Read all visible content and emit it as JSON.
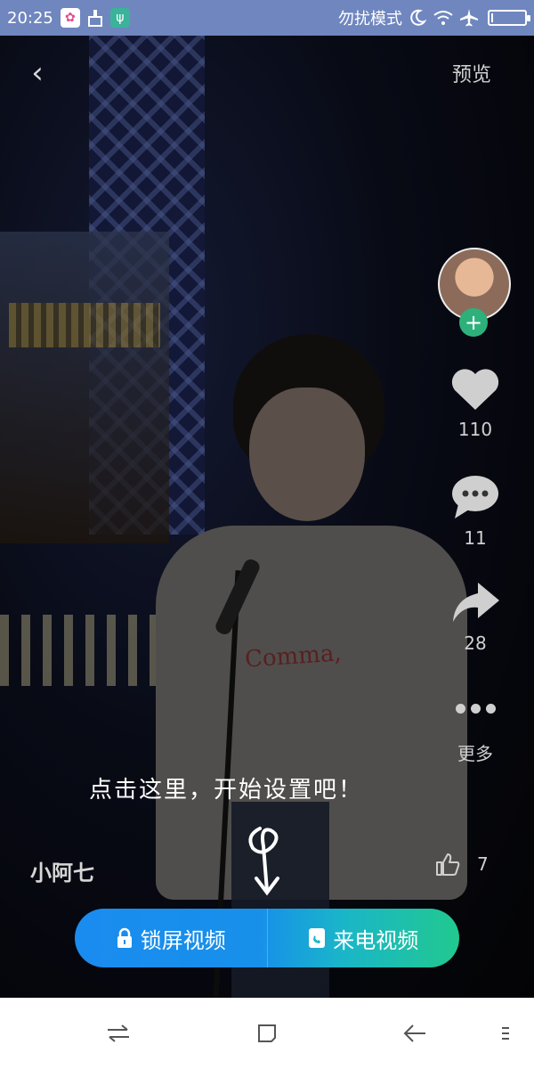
{
  "status_bar": {
    "time": "20:25",
    "dnd_label": "勿扰模式"
  },
  "top_nav": {
    "back_glyph": "‹",
    "preview_label": "预览"
  },
  "right_rail": {
    "likes_count": "110",
    "comments_count": "11",
    "shares_count": "28",
    "more_label": "更多"
  },
  "video": {
    "shirt_text": "Comma,",
    "username": "小阿七",
    "small_like_count": "7",
    "hint": "点击这里，开始设置吧！"
  },
  "action_bar": {
    "lock_screen_label": "锁屏视频",
    "call_video_label": "来电视频"
  },
  "colors": {
    "status_bar": "#6f86bf",
    "follow_green": "#2eb07b",
    "action_blue": "#1a8cf0",
    "action_green": "#21c98f"
  },
  "icons": [
    "back-icon",
    "heart-icon",
    "comment-icon",
    "share-icon",
    "more-dots-icon",
    "thumb-up-icon",
    "lock-icon",
    "phone-video-icon",
    "wifi-icon",
    "airplane-icon",
    "moon-icon",
    "battery-icon"
  ]
}
